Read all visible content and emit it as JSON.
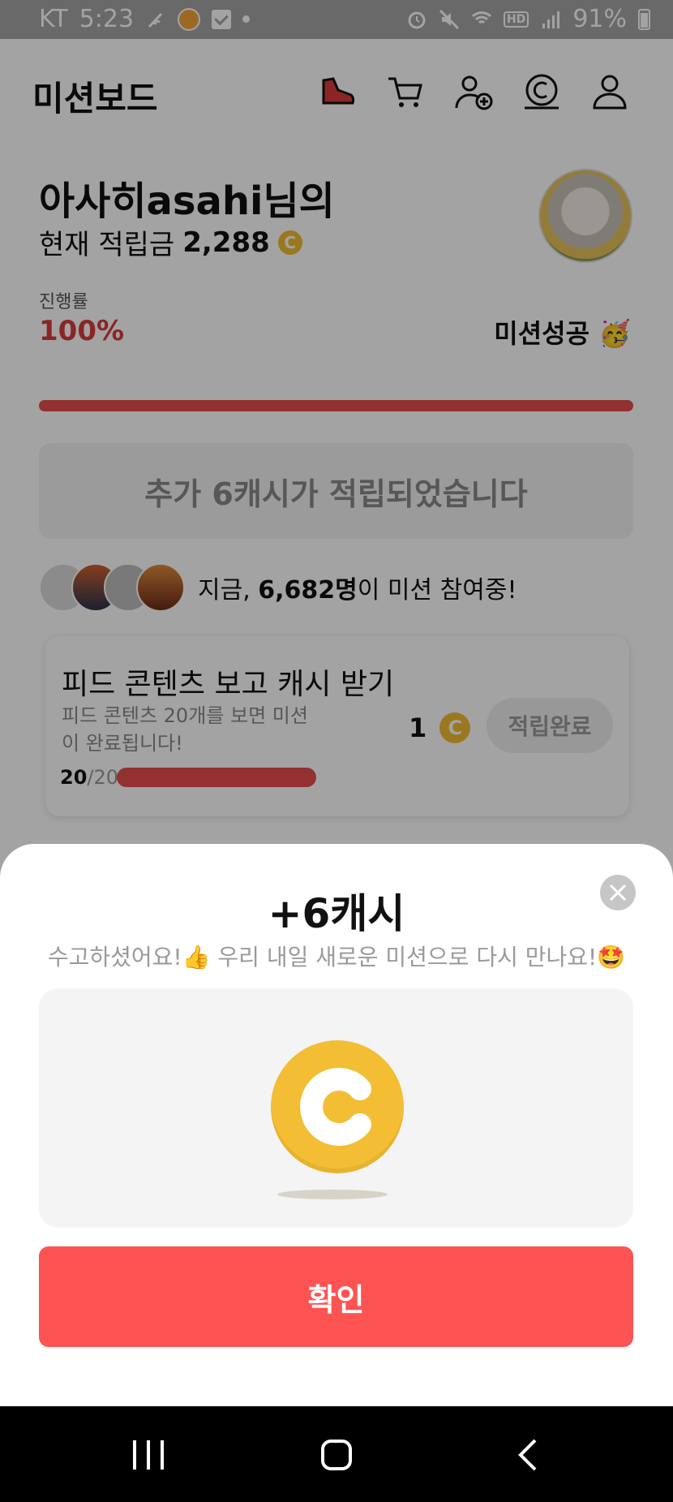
{
  "status_bar": {
    "carrier": "KT",
    "time": "5:23",
    "battery": "91%",
    "hd_label": "HD"
  },
  "header": {
    "title": "미션보드",
    "icons": [
      "sneaker-icon",
      "cart-icon",
      "add-user-icon",
      "cash-icon",
      "profile-icon"
    ]
  },
  "user": {
    "name": "아사히asahi님의",
    "points_label": "현재 적립금",
    "points_value": "2,288"
  },
  "progress": {
    "label": "진행률",
    "value": "100%",
    "fraction": 1.0,
    "status": "미션성공 🥳"
  },
  "bonus_message": "추가 6캐시가 적립되었습니다",
  "participants": {
    "prefix": "지금, ",
    "count": "6,682명",
    "suffix": "이 미션 참여중!"
  },
  "mission": {
    "title": "피드 콘텐츠 보고 캐시 받기",
    "description": "피드 콘텐츠 20개를 보면 미션이 완료됩니다!",
    "current": "20",
    "total": "/20",
    "reward": "1",
    "button": "적립완료"
  },
  "sheet": {
    "title": "+6캐시",
    "message": "수고하셨어요!👍 우리 내일 새로운 미션으로 다시 만나요!🤩",
    "confirm_label": "확인"
  },
  "colors": {
    "accent": "#e74c4c",
    "coin": "#f3bd34",
    "confirm": "#fd5453"
  }
}
